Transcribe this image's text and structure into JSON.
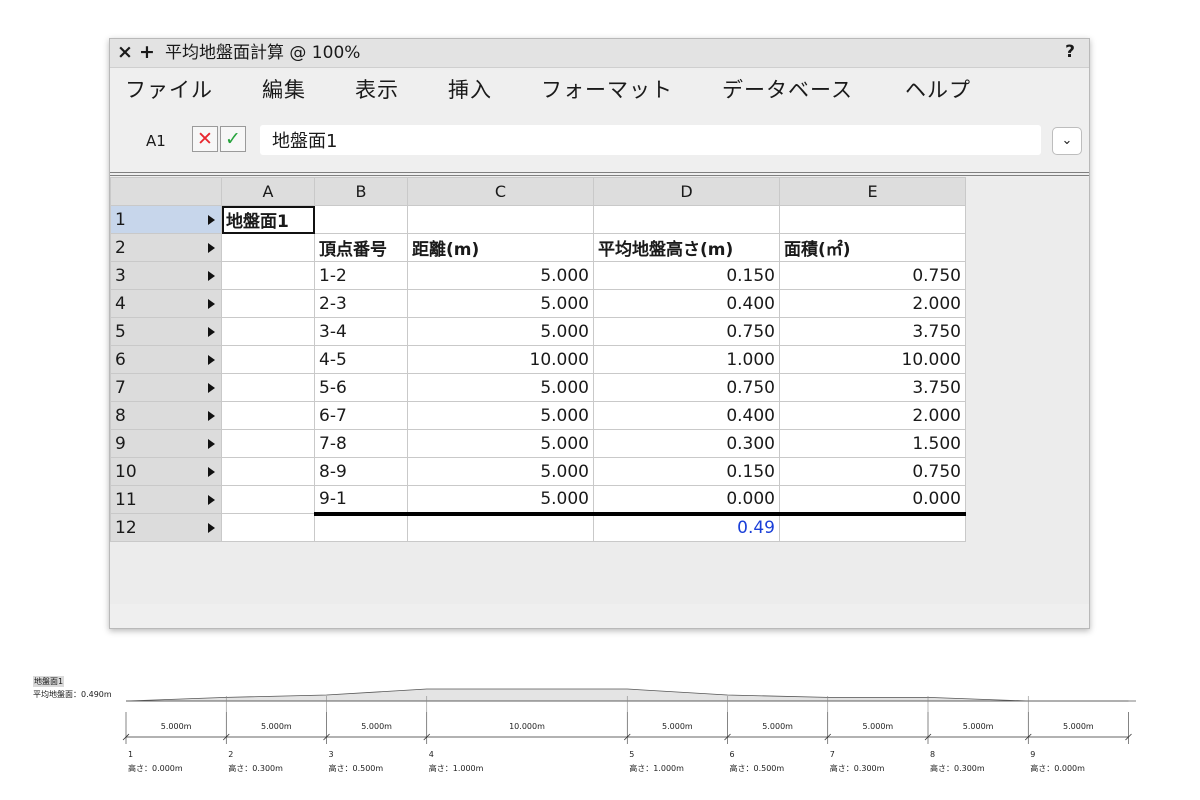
{
  "window": {
    "close_icon": "×",
    "plus_icon": "+",
    "title": "平均地盤面計算 @ 100%",
    "help": "?"
  },
  "menu": {
    "file": "ファイル",
    "edit": "編集",
    "view": "表示",
    "insert": "挿入",
    "format": "フォーマット",
    "database": "データベース",
    "help": "ヘルプ"
  },
  "formula_bar": {
    "cell_ref": "A1",
    "cancel_icon": "✕",
    "accept_icon": "✓",
    "value": "地盤面1",
    "dropdown_icon": "⌄"
  },
  "sheet": {
    "columns": [
      "A",
      "B",
      "C",
      "D",
      "E"
    ],
    "active_column": "A",
    "rows": [
      {
        "num": "1",
        "a": "地盤面1",
        "b": "",
        "c": "",
        "d": "",
        "e": ""
      },
      {
        "num": "2",
        "a": "",
        "b": "頂点番号",
        "c": "距離(m)",
        "d": "平均地盤高さ(m)",
        "e": "面積(㎡)"
      },
      {
        "num": "3",
        "a": "",
        "b": "1-2",
        "c": "5.000",
        "d": "0.150",
        "e": "0.750"
      },
      {
        "num": "4",
        "a": "",
        "b": "2-3",
        "c": "5.000",
        "d": "0.400",
        "e": "2.000"
      },
      {
        "num": "5",
        "a": "",
        "b": "3-4",
        "c": "5.000",
        "d": "0.750",
        "e": "3.750"
      },
      {
        "num": "6",
        "a": "",
        "b": "4-5",
        "c": "10.000",
        "d": "1.000",
        "e": "10.000"
      },
      {
        "num": "7",
        "a": "",
        "b": "5-6",
        "c": "5.000",
        "d": "0.750",
        "e": "3.750"
      },
      {
        "num": "8",
        "a": "",
        "b": "6-7",
        "c": "5.000",
        "d": "0.400",
        "e": "2.000"
      },
      {
        "num": "9",
        "a": "",
        "b": "7-8",
        "c": "5.000",
        "d": "0.300",
        "e": "1.500"
      },
      {
        "num": "10",
        "a": "",
        "b": "8-9",
        "c": "5.000",
        "d": "0.150",
        "e": "0.750"
      },
      {
        "num": "11",
        "a": "",
        "b": "9-1",
        "c": "5.000",
        "d": "0.000",
        "e": "0.000"
      },
      {
        "num": "12",
        "a": "",
        "b": "",
        "c": "",
        "d": "0.49",
        "e": ""
      }
    ]
  },
  "drawing": {
    "title": "地盤面1",
    "average": "平均地盤面：0.490m",
    "segments": [
      "5.000m",
      "5.000m",
      "5.000m",
      "10.000m",
      "5.000m",
      "5.000m",
      "5.000m",
      "5.000m",
      "5.000m"
    ],
    "points": [
      {
        "num": "1",
        "height": "高さ：0.000m"
      },
      {
        "num": "2",
        "height": "高さ：0.300m"
      },
      {
        "num": "3",
        "height": "高さ：0.500m"
      },
      {
        "num": "4",
        "height": "高さ：1.000m"
      },
      {
        "num": "5",
        "height": "高さ：1.000m"
      },
      {
        "num": "6",
        "height": "高さ：0.500m"
      },
      {
        "num": "7",
        "height": "高さ：0.300m"
      },
      {
        "num": "8",
        "height": "高さ：0.300m"
      },
      {
        "num": "9",
        "height": "高さ：0.000m"
      }
    ],
    "profile_heights_m": [
      0.0,
      0.3,
      0.5,
      1.0,
      1.0,
      0.5,
      0.3,
      0.3,
      0.0,
      0.0
    ],
    "colors": {
      "fill": "#e4e4e4",
      "line": "#555555"
    }
  },
  "colors": {
    "active_header": "#c7d6eb",
    "result_text": "#1a3fd8",
    "cancel": "#e8262e",
    "accept": "#26a33c"
  }
}
